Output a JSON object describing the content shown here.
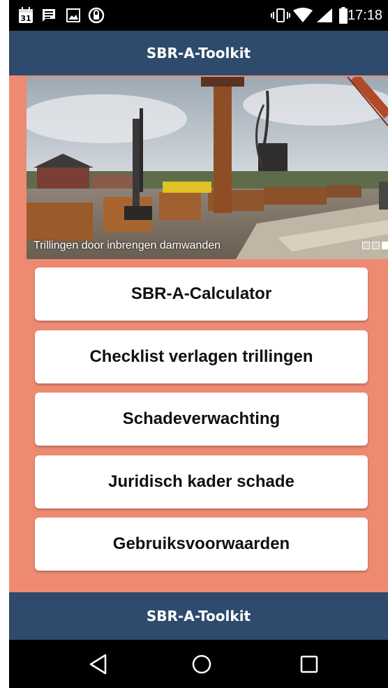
{
  "status_bar": {
    "time": "17:18",
    "calendar_day": "31",
    "icons_left": [
      "calendar-icon",
      "message-icon",
      "image-icon",
      "sync-icon"
    ],
    "icons_right": [
      "vibrate-icon",
      "wifi-icon",
      "signal-icon",
      "battery-icon"
    ]
  },
  "header": {
    "title": "SBR-A-Toolkit"
  },
  "carousel": {
    "caption": "Trillingen door inbrengen damwanden",
    "slide_count": 3,
    "active_index": 2
  },
  "menu": {
    "items": [
      {
        "label": "SBR-A-Calculator"
      },
      {
        "label": "Checklist verlagen trillingen"
      },
      {
        "label": "Schadeverwachting"
      },
      {
        "label": "Juridisch kader schade"
      },
      {
        "label": "Gebruiksvoorwaarden"
      }
    ]
  },
  "footer": {
    "title": "SBR-A-Toolkit"
  },
  "nav": {
    "buttons": [
      "back-icon",
      "home-icon",
      "recents-icon"
    ]
  },
  "colors": {
    "app_bar": "#2e4a6c",
    "background": "#ee8a72",
    "button": "#ffffff"
  }
}
